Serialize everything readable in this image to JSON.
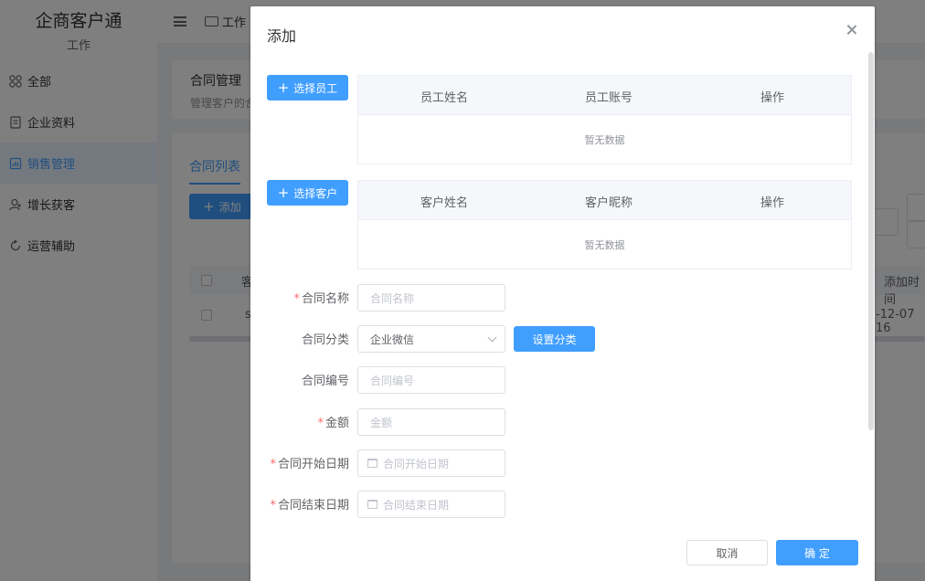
{
  "app": {
    "brand_name": "企商客户通",
    "brand_sub": "工作",
    "top_tab": "工作",
    "menu": [
      {
        "label": "全部"
      },
      {
        "label": "企业资料"
      },
      {
        "label": "销售管理"
      },
      {
        "label": "增长获客"
      },
      {
        "label": "运营辅助"
      }
    ]
  },
  "background": {
    "section_title": "合同管理",
    "section_desc": "管理客户的合",
    "subtab": "合同列表",
    "add_button": "添加",
    "col_partial": "客",
    "col_add_time": "添加时间",
    "row_partial": "s",
    "row_time_partial": "-12-07 16"
  },
  "dialog": {
    "title": "添加",
    "select_employee_button": "选择员工",
    "employee_table": {
      "headers": [
        "员工姓名",
        "员工账号",
        "操作"
      ],
      "empty_text": "暂无数据"
    },
    "select_customer_button": "选择客户",
    "customer_table": {
      "headers": [
        "客户姓名",
        "客户昵称",
        "操作"
      ],
      "empty_text": "暂无数据"
    },
    "form": {
      "contract_name": {
        "label": "合同名称",
        "placeholder": "合同名称",
        "required": true
      },
      "contract_category": {
        "label": "合同分类",
        "value": "企业微信",
        "set_button": "设置分类"
      },
      "contract_number": {
        "label": "合同编号",
        "placeholder": "合同编号"
      },
      "amount": {
        "label": "金额",
        "placeholder": "金额",
        "required": true
      },
      "start_date": {
        "label": "合同开始日期",
        "placeholder": "合同开始日期",
        "required": true
      },
      "end_date": {
        "label": "合同结束日期",
        "placeholder": "合同结束日期",
        "required": true
      }
    },
    "cancel_button": "取消",
    "confirm_button": "确 定"
  },
  "colors": {
    "primary": "#409eff",
    "required": "#f56c6c"
  }
}
